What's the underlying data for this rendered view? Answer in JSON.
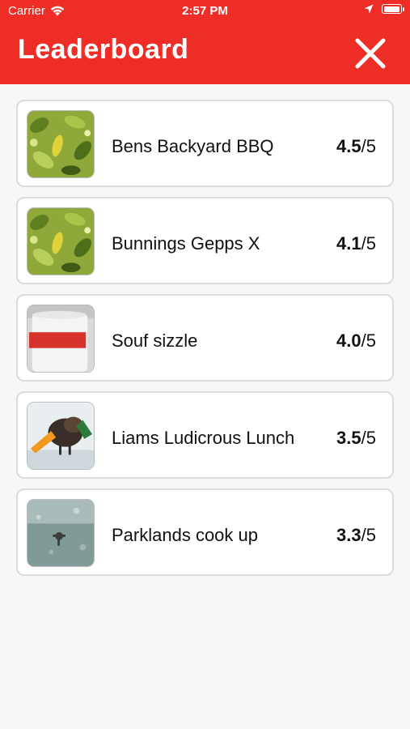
{
  "status": {
    "carrier": "Carrier",
    "time": "2:57 PM"
  },
  "header": {
    "title": "Leaderboard",
    "close_icon": "close-icon"
  },
  "entries": [
    {
      "name": "Bens Backyard BBQ",
      "score": "4.5",
      "out_of": "/5",
      "image": "leaves"
    },
    {
      "name": "Bunnings Gepps X",
      "score": "4.1",
      "out_of": "/5",
      "image": "leaves"
    },
    {
      "name": "Souf sizzle",
      "score": "4.0",
      "out_of": "/5",
      "image": "mug"
    },
    {
      "name": "Liams Ludicrous Lunch",
      "score": "3.5",
      "out_of": "/5",
      "image": "bird"
    },
    {
      "name": "Parklands cook up",
      "score": "3.3",
      "out_of": "/5",
      "image": "water"
    }
  ],
  "colors": {
    "header_bg": "#ee2e26",
    "page_bg": "#f7f7f7",
    "card_border": "#dcdcdc"
  }
}
